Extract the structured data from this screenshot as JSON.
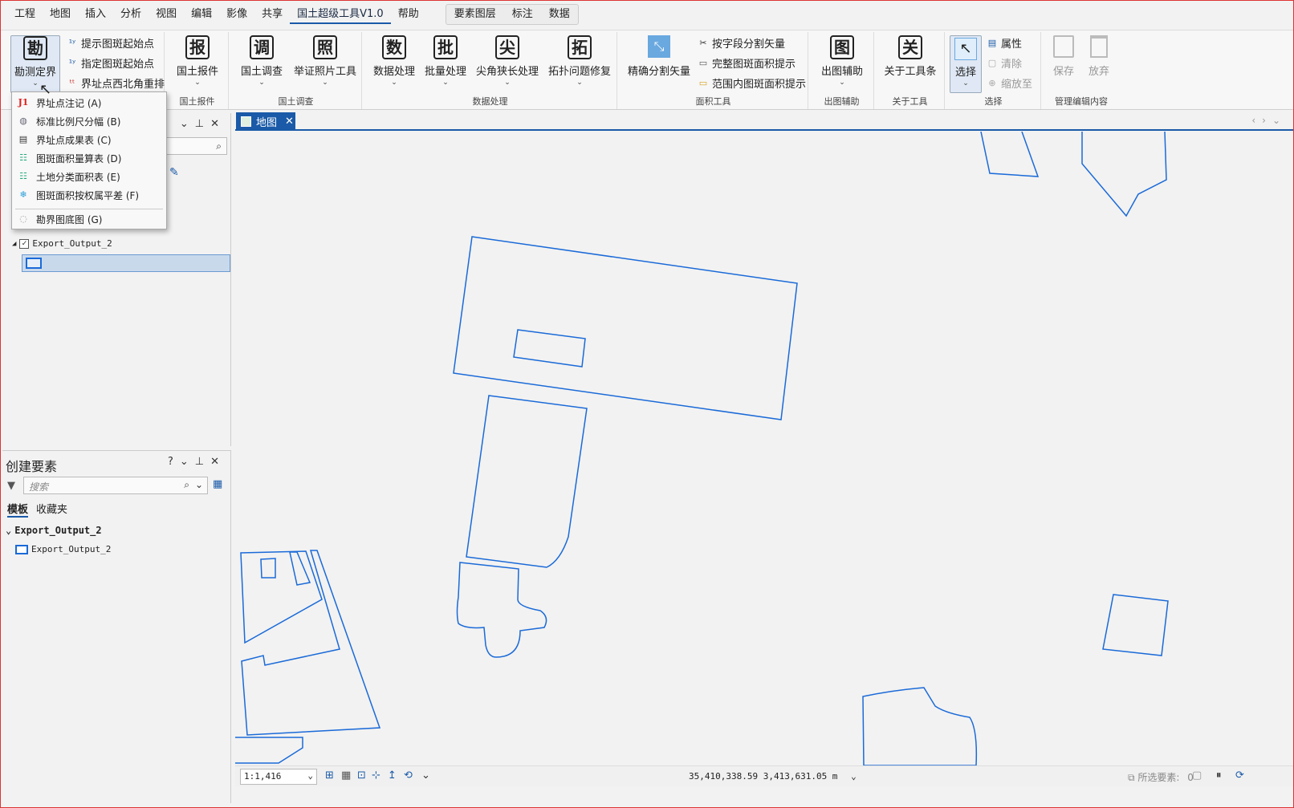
{
  "menu": {
    "tabs": [
      "工程",
      "地图",
      "插入",
      "分析",
      "视图",
      "编辑",
      "影像",
      "共享",
      "国土超级工具V1.0",
      "帮助"
    ],
    "context_tabs": [
      "要素图层",
      "标注",
      "数据"
    ],
    "active_tab": "国土超级工具V1.0"
  },
  "ribbon": {
    "survey": {
      "label": "勘测定界",
      "icon_char": "勘"
    },
    "survey_small": [
      "提示图斑起始点",
      "指定图斑起始点",
      "界址点西北角重排"
    ],
    "report": {
      "label": "国土报件",
      "icon_char": "报",
      "group": "国土报件"
    },
    "investigate": {
      "label": "国土调查",
      "icon_char": "调"
    },
    "photo": {
      "label": "举证照片工具",
      "icon_char": "照"
    },
    "investigate_group": "国土调查",
    "data_proc": {
      "label": "数据处理",
      "icon_char": "数"
    },
    "batch": {
      "label": "批量处理",
      "icon_char": "批"
    },
    "sharp": {
      "label": "尖角狭长处理",
      "icon_char": "尖"
    },
    "topo": {
      "label": "拓扑问题修复",
      "icon_char": "拓"
    },
    "data_group": "数据处理",
    "split": {
      "label": "精确分割矢量"
    },
    "area_small": [
      "按字段分割矢量",
      "完整图斑面积提示",
      "范围内图斑面积提示"
    ],
    "area_group": "面积工具",
    "mapout": {
      "label": "出图辅助",
      "icon_char": "图",
      "group": "出图辅助"
    },
    "about": {
      "label": "关于工具条",
      "icon_char": "关",
      "group": "关于工具"
    },
    "select": {
      "label": "选择",
      "group": "选择"
    },
    "select_small": [
      "属性",
      "清除",
      "缩放至"
    ],
    "save": {
      "label": "保存"
    },
    "discard": {
      "label": "放弃"
    },
    "manage_group": "管理编辑内容"
  },
  "dropdown": {
    "items": [
      {
        "label": "界址点注记 (A)",
        "icon": "j1-icon",
        "glyph": "J1"
      },
      {
        "label": "标准比例尺分幅 (B)",
        "icon": "globe-icon",
        "glyph": "◍"
      },
      {
        "label": "界址点成果表 (C)",
        "icon": "table-icon",
        "glyph": "▤"
      },
      {
        "label": "图斑面积量算表 (D)",
        "icon": "table-icon",
        "glyph": "☷"
      },
      {
        "label": "土地分类面积表 (E)",
        "icon": "table-icon",
        "glyph": "☷"
      },
      {
        "label": "图斑面积按权属平差 (F)",
        "icon": "snowflake-icon",
        "glyph": "❄"
      },
      {
        "label": "勘界图底图 (G)",
        "icon": "map-icon",
        "glyph": "◌"
      }
    ]
  },
  "contents_panel": {
    "layer_name": "Export_Output_2"
  },
  "create_panel": {
    "title": "创建要素",
    "search_placeholder": "搜索",
    "tabs": [
      "模板",
      "收藏夹"
    ],
    "group_name": "Export_Output_2",
    "template_name": "Export_Output_2"
  },
  "map": {
    "tab_label": "地图",
    "polygon_color": "#1a6ad8"
  },
  "status": {
    "scale": "1:1,416",
    "coords": "35,410,338.59 3,413,631.05 m",
    "selected_label": "所选要素:",
    "selected_count": "0"
  }
}
